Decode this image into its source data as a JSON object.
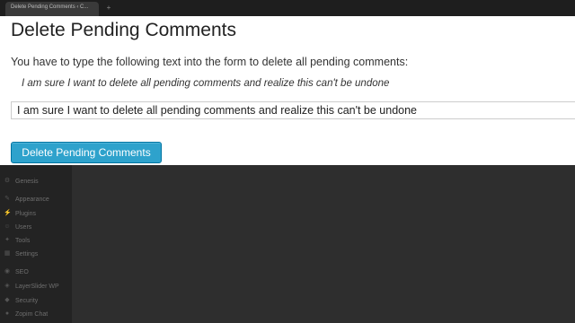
{
  "browser": {
    "tab_title": "Delete Pending Comments ‹ C...",
    "new_tab_symbol": "+"
  },
  "dialog": {
    "title": "Delete Pending Comments",
    "instruction": "You have to type the following text into the form to delete all pending comments:",
    "required_text": "I am sure I want to delete all pending comments and realize this can't be undone",
    "input_value": "I am sure I want to delete all pending comments and realize this can't be undone",
    "button_label": "Delete Pending Comments"
  },
  "sidebar": {
    "items": [
      {
        "label": "Genesis",
        "icon": "gear-icon"
      },
      {
        "label": "Appearance",
        "icon": "brush-icon"
      },
      {
        "label": "Plugins",
        "icon": "plugin-icon"
      },
      {
        "label": "Users",
        "icon": "user-icon"
      },
      {
        "label": "Tools",
        "icon": "wrench-icon"
      },
      {
        "label": "Settings",
        "icon": "settings-icon"
      },
      {
        "label": "SEO",
        "icon": "seo-icon"
      },
      {
        "label": "LayerSlider WP",
        "icon": "layers-icon"
      },
      {
        "label": "Security",
        "icon": "shield-icon"
      },
      {
        "label": "Zopim Chat",
        "icon": "chat-icon"
      }
    ]
  },
  "colors": {
    "button": "#2ea2cc",
    "sidebar_bg": "#232323",
    "content_bg": "#2e2e2e"
  }
}
